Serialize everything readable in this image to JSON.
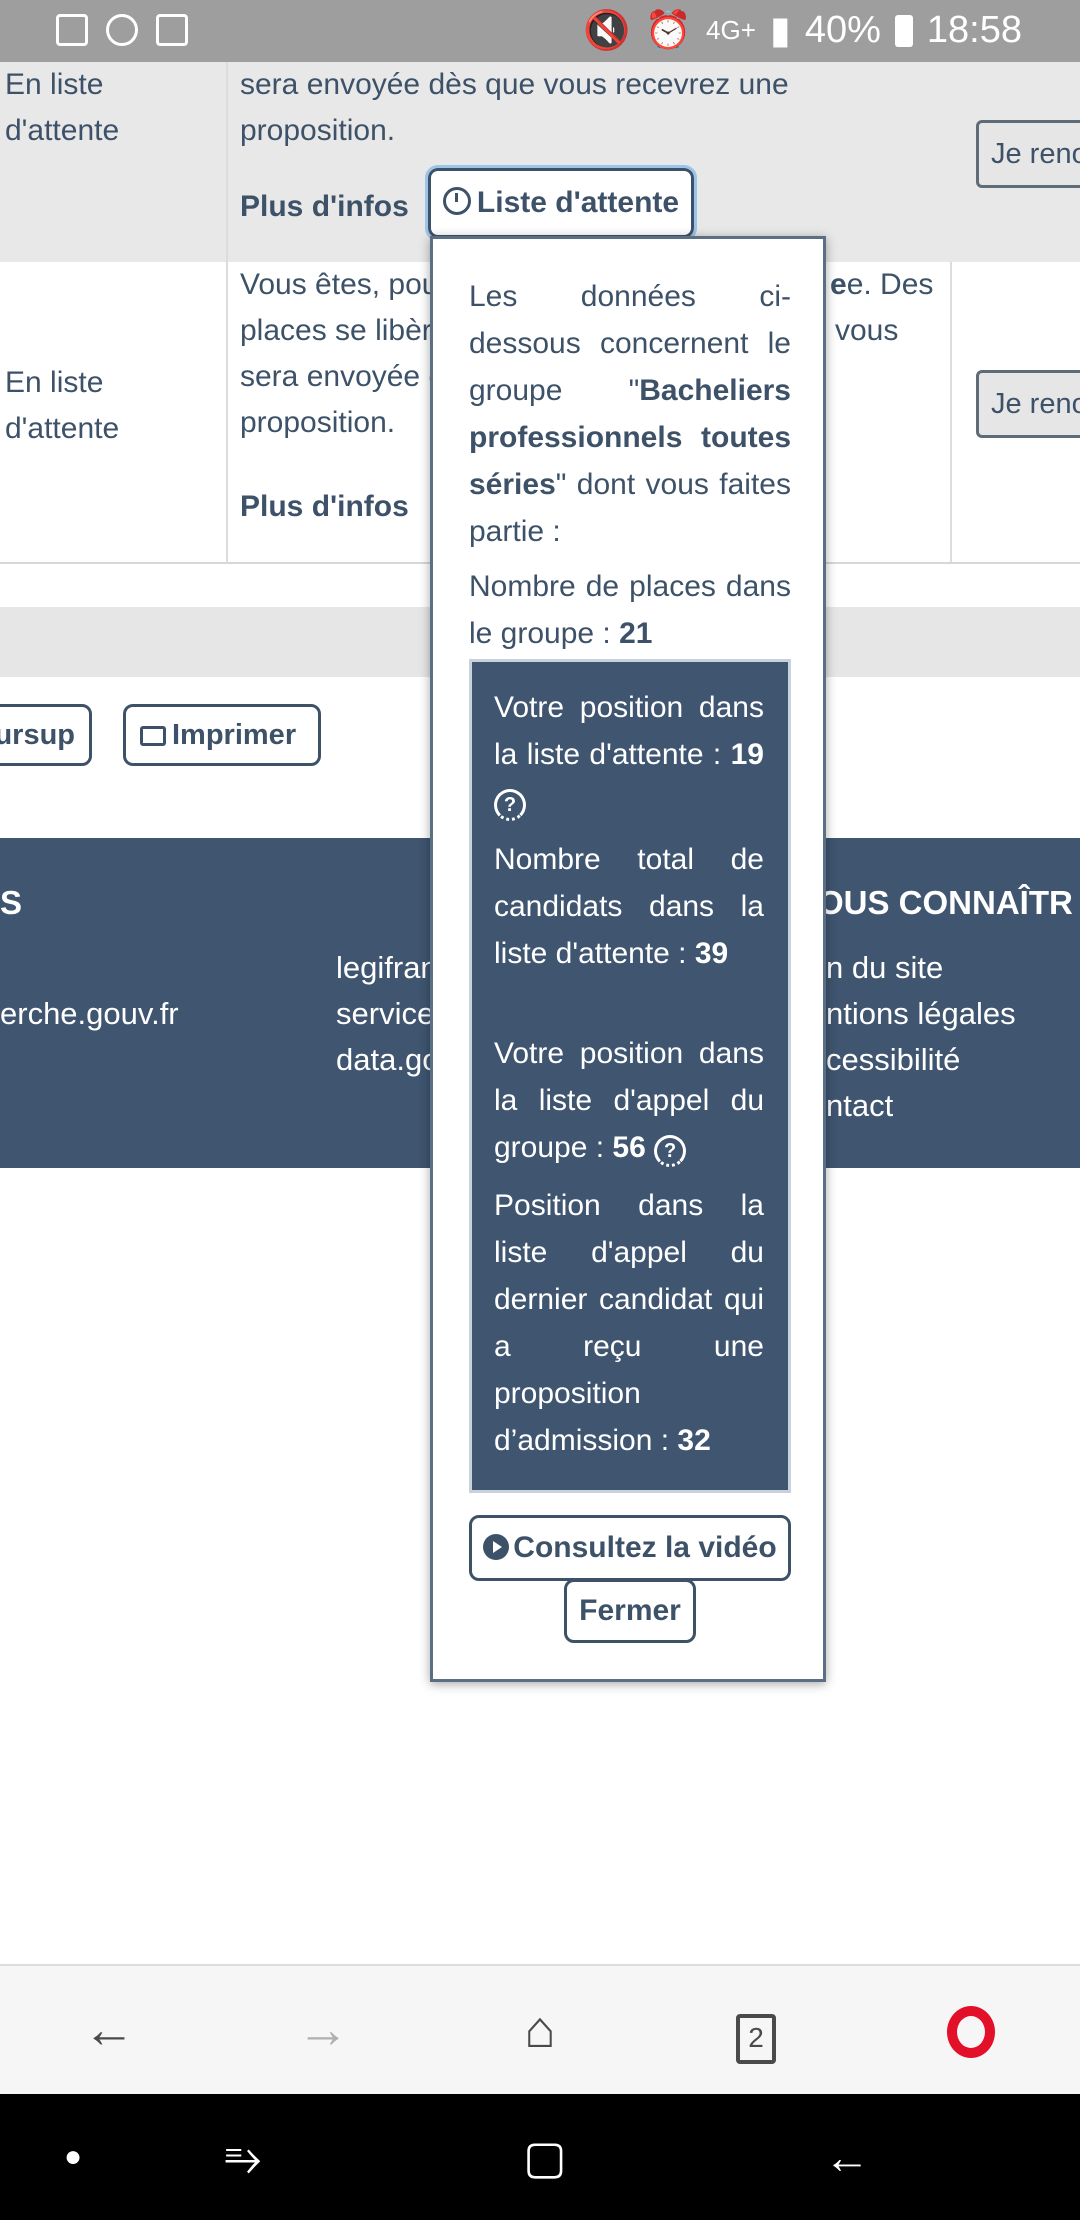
{
  "status_bar": {
    "network": "4G+",
    "battery": "40%",
    "time": "18:58"
  },
  "rows": [
    {
      "status": "En liste d'attente",
      "description": "sera envoyée dès que vous recevrez une proposition.",
      "more_info": "Plus d'infos",
      "waitlist_button": "Liste d'attente",
      "action_button": "Je renoncer"
    },
    {
      "status": "En liste d'attente",
      "description_line1": "Vous êtes, pou",
      "description_line1_end": "e. Des",
      "description_line2": "places se libèr",
      "description_line2_end": "vous",
      "description_line3": "sera envoyée d",
      "description_line4": "proposition.",
      "more_info": "Plus d'infos",
      "action_button": "Je renoncer"
    }
  ],
  "actions": {
    "parcoursup_label": "ursup",
    "print_label": "Imprimer"
  },
  "footer": {
    "heading_left": "S",
    "heading_right": "OUS CONNAÎTR",
    "link_left": "erche.gouv.fr",
    "links_middle": [
      "legifran",
      "service",
      "data.go"
    ],
    "links_right": [
      "n du site",
      "ntions légales",
      "cessibilité",
      "ntact"
    ]
  },
  "popover": {
    "intro_prefix": "Les données ci-dessous concernent le groupe \"",
    "group_name": "Bacheliers professionnels toutes séries",
    "intro_suffix": "\" dont vous faites partie :",
    "places_label": "Nombre de places dans le groupe : ",
    "places_value": "21",
    "position_label": "Votre position dans la liste d'attente : ",
    "position_value": "19",
    "total_label": "Nombre total de candidats dans la liste d'attente : ",
    "total_value": "39",
    "call_position_label": "Votre position dans la liste d'appel du groupe : ",
    "call_position_value": "56",
    "last_label": "Position dans la liste d'appel du dernier candidat qui a reçu une proposition d’admission : ",
    "last_value": "32",
    "help_glyph": "?",
    "video_button": "Consultez la vidéo",
    "close_button": "Fermer"
  },
  "browser_bar": {
    "tab_count": "2"
  }
}
